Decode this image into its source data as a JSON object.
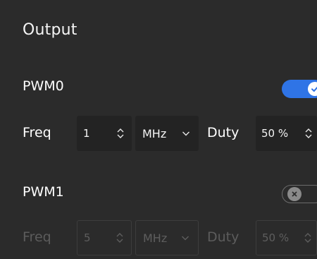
{
  "output": {
    "title": "Output",
    "channels": [
      {
        "label": "PWM0",
        "enabled": true,
        "freq_label": "Freq",
        "freq_value": "1",
        "unit": "MHz",
        "duty_label": "Duty",
        "duty_value": "50 %"
      },
      {
        "label": "PWM1",
        "enabled": false,
        "freq_label": "Freq",
        "freq_value": "5",
        "unit": "MHz",
        "duty_label": "Duty",
        "duty_value": "50 %"
      }
    ]
  },
  "colors": {
    "background": "#2b2b2b",
    "accent": "#2f74e6",
    "text": "#ffffff",
    "disabled_text": "#5c5c5c"
  },
  "icons": {
    "toggle_on": "check-icon",
    "toggle_off": "x-icon",
    "stepper": "up-down-chevron-icon",
    "dropdown": "chevron-down-icon"
  }
}
